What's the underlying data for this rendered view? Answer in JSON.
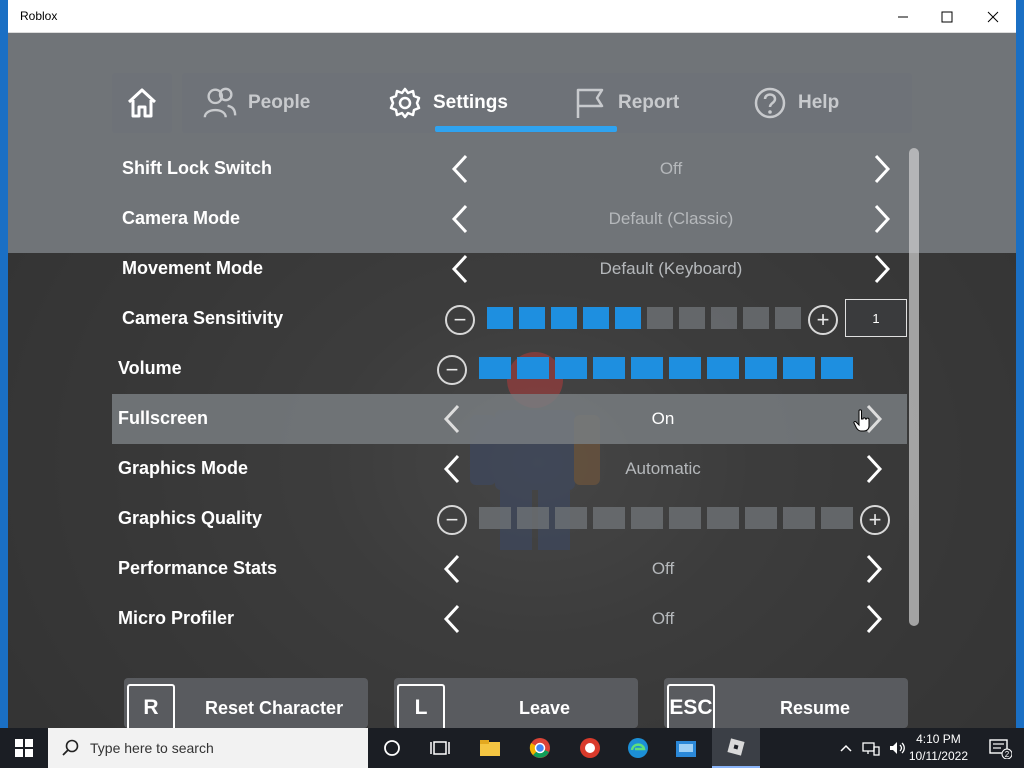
{
  "window": {
    "title": "Roblox"
  },
  "tabs": {
    "home_label": "",
    "items": [
      {
        "label": "People",
        "icon": "people-icon"
      },
      {
        "label": "Settings",
        "icon": "gear-icon"
      },
      {
        "label": "Report",
        "icon": "flag-icon"
      },
      {
        "label": "Help",
        "icon": "help-icon"
      }
    ],
    "active": "Settings"
  },
  "settings": [
    {
      "label": "Shift Lock Switch",
      "value": "Off"
    },
    {
      "label": "Camera Mode",
      "value": "Default (Classic)"
    },
    {
      "label": "Movement Mode",
      "value": "Default (Keyboard)"
    },
    {
      "label": "Camera Sensitivity",
      "value": "1",
      "level_fraction": 0.5
    },
    {
      "label": "Volume",
      "level_fraction": 1.0
    },
    {
      "label": "Fullscreen",
      "value": "On"
    },
    {
      "label": "Graphics Mode",
      "value": "Automatic"
    },
    {
      "label": "Graphics Quality",
      "level_fraction": 0.0
    },
    {
      "label": "Performance Stats",
      "value": "Off"
    },
    {
      "label": "Micro Profiler",
      "value": "Off"
    }
  ],
  "buttons": [
    {
      "key": "R",
      "label": "Reset Character"
    },
    {
      "key": "L",
      "label": "Leave"
    },
    {
      "key": "ESC",
      "label": "Resume"
    }
  ],
  "taskbar": {
    "search_placeholder": "Type here to search",
    "time": "4:10 PM",
    "date": "10/11/2022",
    "notification_count": "2"
  },
  "colors": {
    "accent": "#2fa3f0",
    "slider_on": "#1e8fe0",
    "taskbar": "#1b1e24"
  }
}
